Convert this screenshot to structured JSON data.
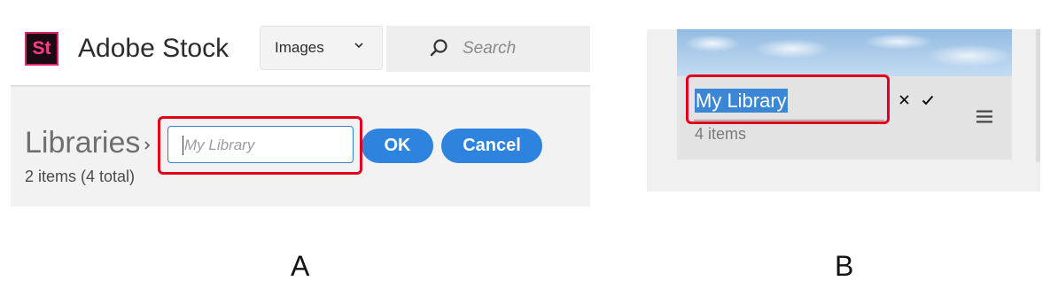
{
  "panel_a": {
    "header": {
      "logo_text": "St",
      "app_name": "Adobe Stock",
      "type_select_value": "Images",
      "search_placeholder": "Search"
    },
    "library": {
      "title": "Libraries",
      "item_count": "2 items (4 total)",
      "name_input_placeholder": "My Library",
      "ok_label": "OK",
      "cancel_label": "Cancel"
    },
    "caption": "A"
  },
  "panel_b": {
    "library_name_value": "My Library",
    "item_count": "4 items",
    "caption": "B"
  },
  "icons": {
    "type_select_arrow": "chevron-down-icon",
    "search": "search-icon",
    "breadcrumb_separator": "chevron-right-icon",
    "cancel_edit": "close-icon",
    "confirm_edit": "checkmark-icon",
    "more_menu": "hamburger-menu-icon"
  },
  "colors": {
    "accent": "#2e83df",
    "highlight_box": "#e0001a",
    "selection": "#3c86d6",
    "logo_background": "#1c0a13",
    "logo_text": "#ff3d8a"
  }
}
